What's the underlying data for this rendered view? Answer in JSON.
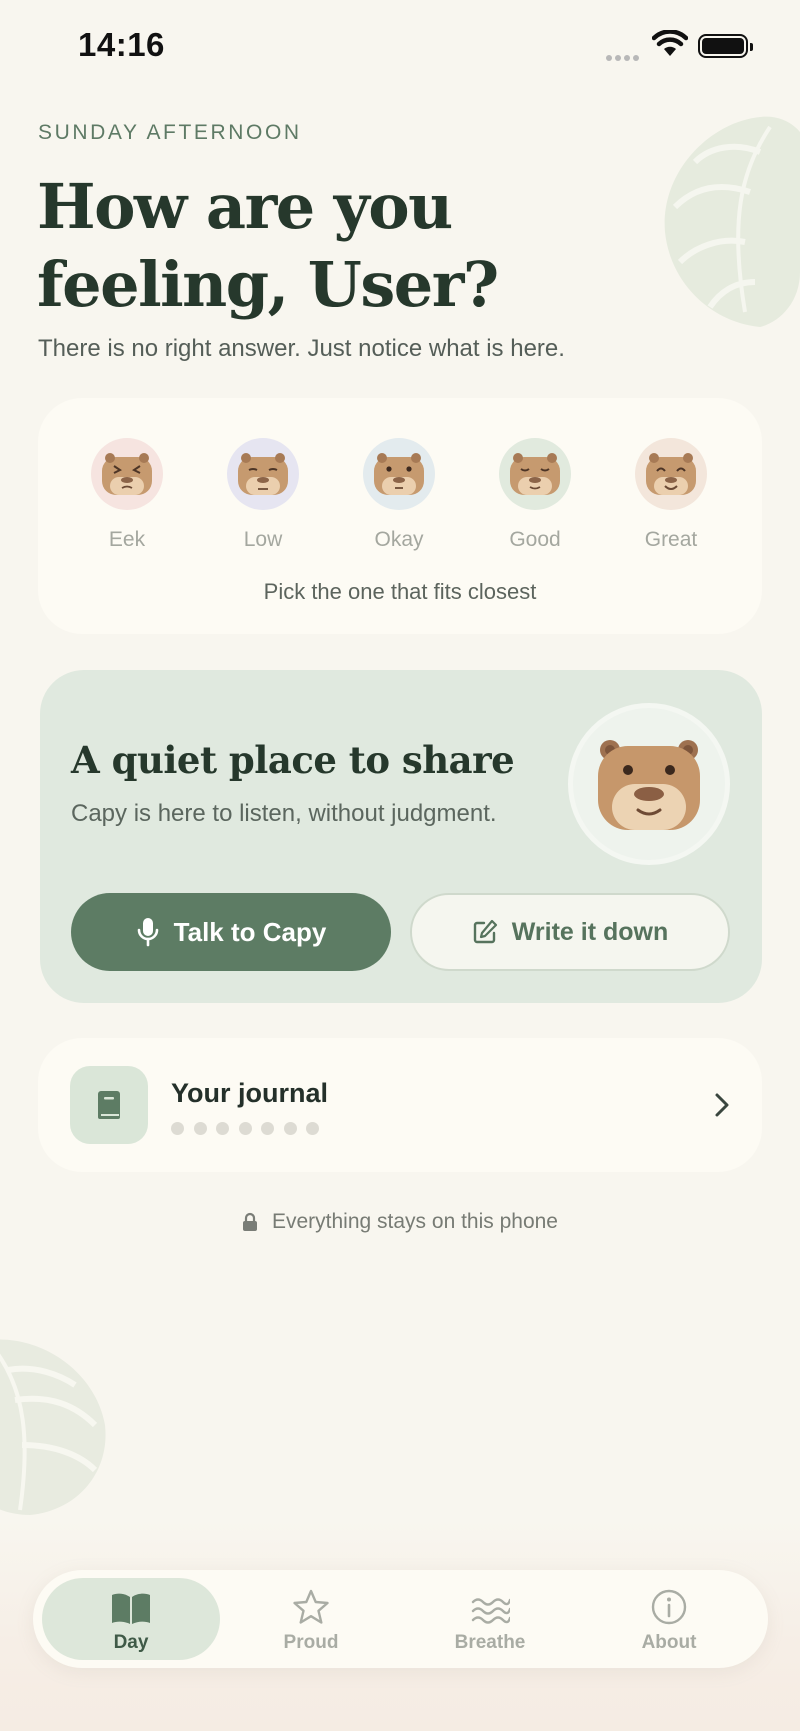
{
  "status": {
    "time": "14:16"
  },
  "header": {
    "eyebrow": "SUNDAY AFTERNOON",
    "title_line1": "How are you",
    "title_line2": "feeling, User?",
    "subtitle": "There is no right answer. Just notice what is here."
  },
  "moods": {
    "items": [
      {
        "label": "Eek",
        "color": "#f6e4e0"
      },
      {
        "label": "Low",
        "color": "#e6e5f1"
      },
      {
        "label": "Okay",
        "color": "#e3ebee"
      },
      {
        "label": "Good",
        "color": "#e1eade"
      },
      {
        "label": "Great",
        "color": "#f3e6db"
      }
    ],
    "hint": "Pick the one that fits closest"
  },
  "share": {
    "title": "A quiet place to share",
    "subtitle": "Capy is here to listen, without judgment.",
    "talk_label": "Talk to Capy",
    "write_label": "Write it down"
  },
  "journal": {
    "title": "Your journal",
    "entries_shown": 7
  },
  "privacy_note": "Everything stays on this phone",
  "tabs": [
    {
      "label": "Day",
      "icon": "book-open-icon",
      "active": true
    },
    {
      "label": "Proud",
      "icon": "star-icon",
      "active": false
    },
    {
      "label": "Breathe",
      "icon": "waves-icon",
      "active": false
    },
    {
      "label": "About",
      "icon": "info-icon",
      "active": false
    }
  ],
  "colors": {
    "background": "#f8f6ef",
    "accent": "#5d7c64",
    "card": "#fdfbf4",
    "share_card": "#e0e9df"
  }
}
